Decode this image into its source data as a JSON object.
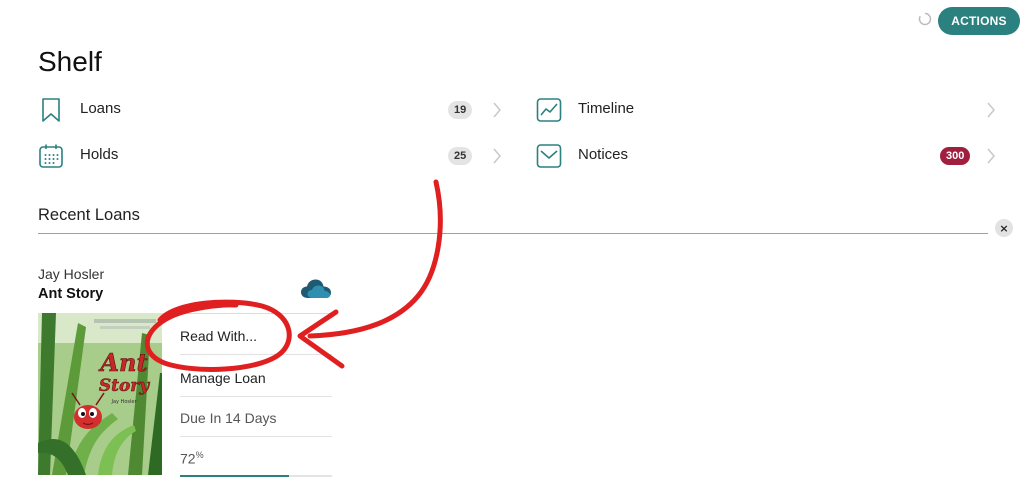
{
  "header": {
    "actions_label": "ACTIONS"
  },
  "page": {
    "title": "Shelf"
  },
  "shelf_nav": {
    "loans": {
      "label": "Loans",
      "count": "19",
      "icon": "bookmark-icon"
    },
    "holds": {
      "label": "Holds",
      "count": "25",
      "icon": "calendar-icon"
    },
    "timeline": {
      "label": "Timeline",
      "icon": "chart-line-icon"
    },
    "notices": {
      "label": "Notices",
      "count": "300",
      "icon": "envelope-icon"
    }
  },
  "recent_loans": {
    "title": "Recent Loans",
    "close_label": "×",
    "loan": {
      "author": "Jay Hosler",
      "title": "Ant Story",
      "cover": {
        "title_line1": "Ant",
        "title_line2": "Story",
        "author": "Jay Hosler"
      },
      "menu": {
        "read_with": "Read With...",
        "manage_loan": "Manage Loan",
        "due": "Due In 14 Days",
        "progress_value": "72",
        "progress_unit": "%"
      },
      "progress_fraction": 0.72
    }
  },
  "colors": {
    "accent": "#2b8080",
    "notice_badge": "#a01f3f",
    "annotation_red": "#e02020"
  }
}
